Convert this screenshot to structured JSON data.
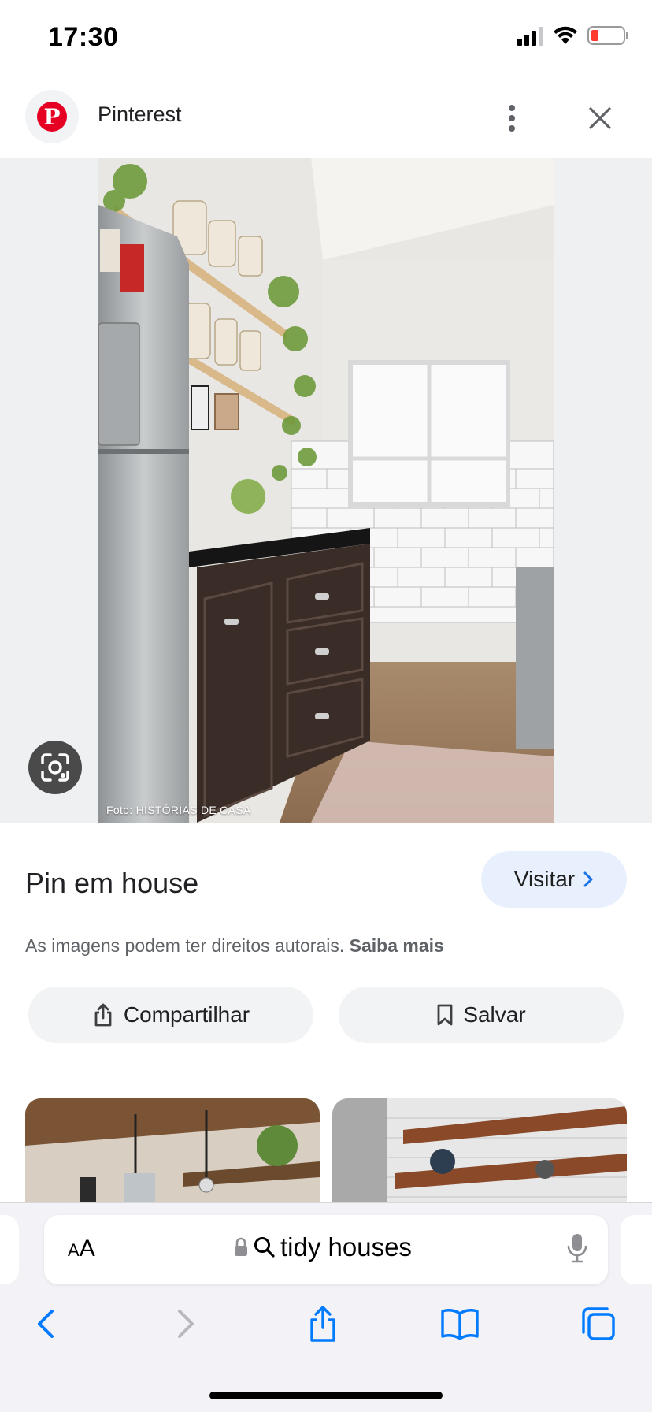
{
  "status_bar": {
    "time": "17:30"
  },
  "header": {
    "source_name": "Pinterest"
  },
  "image": {
    "credit": "Foto: HISTÓRIAS DE CASA"
  },
  "pin": {
    "title": "Pin em house",
    "visit_label": "Visitar",
    "copyright_text": "As imagens podem ter direitos autorais.",
    "learn_more": "Saiba mais"
  },
  "actions": {
    "share_label": "Compartilhar",
    "save_label": "Salvar"
  },
  "browser": {
    "text_size_label": "AA",
    "query": "tidy houses"
  },
  "icons": [
    "signal-icon",
    "wifi-icon",
    "battery-icon",
    "pinterest-logo",
    "more-vert-icon",
    "close-icon",
    "lens-icon",
    "chevron-right-icon",
    "share-icon",
    "bookmark-icon",
    "lock-icon",
    "search-icon",
    "mic-icon",
    "back-icon",
    "forward-icon",
    "share-sheet-icon",
    "bookmarks-icon",
    "tabs-icon"
  ],
  "colors": {
    "accent": "#1a73e8",
    "visit_bg": "#e8f0fe",
    "battery_low": "#ff3b30",
    "pinterest_red": "#e60023",
    "safari_blue": "#007aff"
  }
}
